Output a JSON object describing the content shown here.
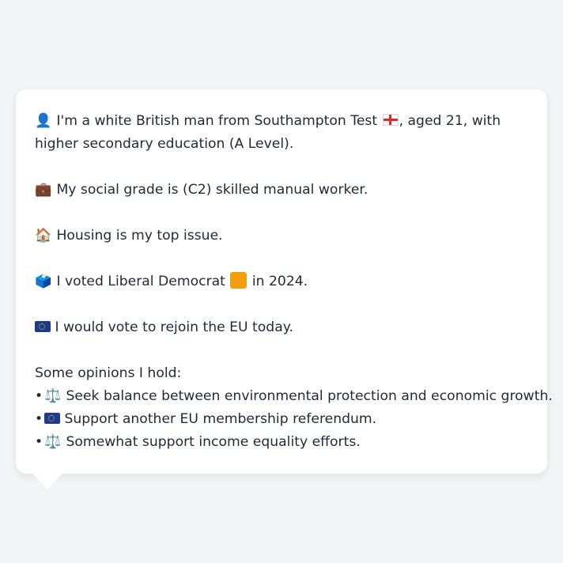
{
  "message": {
    "intro": {
      "icon": "👤",
      "text_before_flag": "I'm a white British man from Southampton Test",
      "flag": "england-flag",
      "text_after_flag": ", aged 21, with higher secondary education (A Level)."
    },
    "social_grade": {
      "icon": "💼",
      "text": "My social grade is (C2) skilled manual worker."
    },
    "housing": {
      "icon": "🏠",
      "text": "Housing is my top issue."
    },
    "vote": {
      "icon": "🗳️",
      "text_before": "I voted Liberal Democrat",
      "party_color": "#f59e0b",
      "text_after": "in 2024."
    },
    "eu": {
      "icon": "eu-flag",
      "text": "I would vote to rejoin the EU today."
    },
    "opinions_heading": "Some opinions I hold:",
    "opinions": [
      {
        "bullet": "•",
        "icon": "⚖️",
        "text": "Seek balance between environmental protection and economic growth."
      },
      {
        "bullet": "•",
        "icon": "eu-flag",
        "text": "Support another EU membership referendum."
      },
      {
        "bullet": "•",
        "icon": "⚖️",
        "text": "Somewhat support income equality efforts."
      }
    ]
  }
}
